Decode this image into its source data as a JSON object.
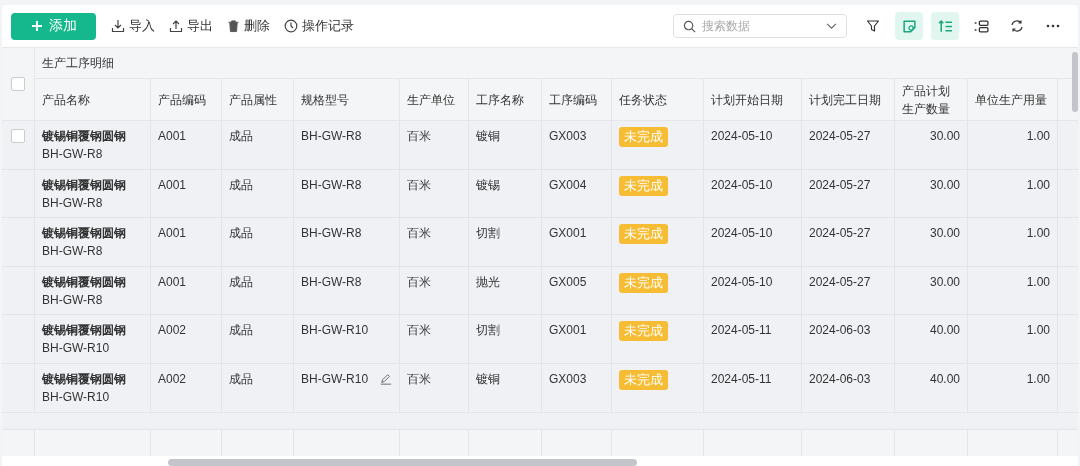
{
  "toolbar": {
    "add_button": "添加",
    "actions": [
      {
        "kind": "import",
        "label": "导入"
      },
      {
        "kind": "export",
        "label": "导出"
      },
      {
        "kind": "delete",
        "label": "删除"
      },
      {
        "kind": "history",
        "label": "操作记录"
      }
    ],
    "search": {
      "placeholder": "搜索数据"
    },
    "tools": [
      {
        "kind": "filter",
        "selected": false
      },
      {
        "kind": "note",
        "selected": true
      },
      {
        "kind": "sort",
        "selected": true
      },
      {
        "kind": "layout",
        "selected": false
      },
      {
        "kind": "refresh",
        "selected": false
      },
      {
        "kind": "more",
        "selected": false
      }
    ]
  },
  "table": {
    "group_header": "生产工序明细",
    "all_checked": false,
    "columns": [
      "产品名称",
      "产品编码",
      "产品属性",
      "规格型号",
      "生产单位",
      "工序名称",
      "工序编码",
      "任务状态",
      "计划开始日期",
      "计划完工日期",
      "产品计划生产数量",
      "单位生产用量"
    ],
    "rows": [
      {
        "checkbox_shown": true,
        "checked": false,
        "edit_icon": false,
        "name": "镀锡铜覆钢圆钢",
        "name_code": "BH-GW-R8",
        "code": "A001",
        "attribute": "成品",
        "spec": "BH-GW-R8",
        "unit": "百米",
        "process": "镀铜",
        "process_code": "GX003",
        "status": "未完成",
        "start": "2024-05-10",
        "end": "2024-05-27",
        "qty": "30.00",
        "usage": "1.00"
      },
      {
        "checkbox_shown": false,
        "edit_icon": false,
        "name": "镀锡铜覆钢圆钢",
        "name_code": "BH-GW-R8",
        "code": "A001",
        "attribute": "成品",
        "spec": "BH-GW-R8",
        "unit": "百米",
        "process": "镀锡",
        "process_code": "GX004",
        "status": "未完成",
        "start": "2024-05-10",
        "end": "2024-05-27",
        "qty": "30.00",
        "usage": "1.00"
      },
      {
        "checkbox_shown": false,
        "edit_icon": false,
        "name": "镀锡铜覆钢圆钢",
        "name_code": "BH-GW-R8",
        "code": "A001",
        "attribute": "成品",
        "spec": "BH-GW-R8",
        "unit": "百米",
        "process": "切割",
        "process_code": "GX001",
        "status": "未完成",
        "start": "2024-05-10",
        "end": "2024-05-27",
        "qty": "30.00",
        "usage": "1.00"
      },
      {
        "checkbox_shown": false,
        "edit_icon": false,
        "name": "镀锡铜覆钢圆钢",
        "name_code": "BH-GW-R8",
        "code": "A001",
        "attribute": "成品",
        "spec": "BH-GW-R8",
        "unit": "百米",
        "process": "抛光",
        "process_code": "GX005",
        "status": "未完成",
        "start": "2024-05-10",
        "end": "2024-05-27",
        "qty": "30.00",
        "usage": "1.00"
      },
      {
        "checkbox_shown": false,
        "edit_icon": false,
        "name": "镀锡铜覆钢圆钢",
        "name_code": "BH-GW-R10",
        "code": "A002",
        "attribute": "成品",
        "spec": "BH-GW-R10",
        "unit": "百米",
        "process": "切割",
        "process_code": "GX001",
        "status": "未完成",
        "start": "2024-05-11",
        "end": "2024-06-03",
        "qty": "40.00",
        "usage": "1.00"
      },
      {
        "checkbox_shown": false,
        "edit_icon": true,
        "name": "镀锡铜覆钢圆钢",
        "name_code": "BH-GW-R10",
        "code": "A002",
        "attribute": "成品",
        "spec": "BH-GW-R10",
        "unit": "百米",
        "process": "镀铜",
        "process_code": "GX003",
        "status": "未完成",
        "start": "2024-05-11",
        "end": "2024-06-03",
        "qty": "40.00",
        "usage": "1.00"
      }
    ]
  }
}
